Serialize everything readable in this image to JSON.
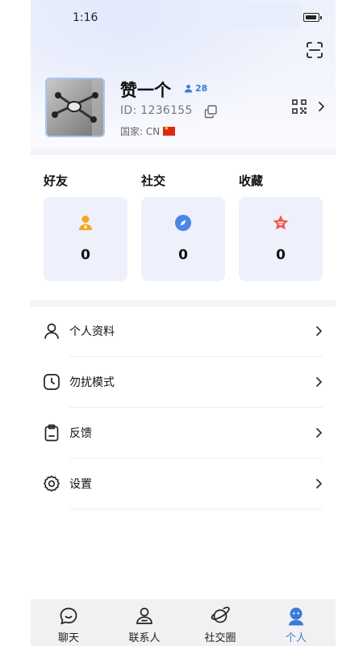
{
  "status_bar": {
    "time": "1:16"
  },
  "profile": {
    "username": "赞一个",
    "fans_count": "28",
    "id_text": "ID: 1236155",
    "country_text": "国家: CN"
  },
  "stats": [
    {
      "title": "好友",
      "value": "0",
      "icon": "friend-icon",
      "color": "#f5a623"
    },
    {
      "title": "社交",
      "value": "0",
      "icon": "compass-icon",
      "color": "#4a86e8"
    },
    {
      "title": "收藏",
      "value": "0",
      "icon": "star-icon",
      "color": "#ee5a4f"
    }
  ],
  "menu": [
    {
      "label": "个人资料",
      "icon": "person-icon"
    },
    {
      "label": "勿扰模式",
      "icon": "clock-icon"
    },
    {
      "label": "反馈",
      "icon": "clipboard-icon"
    },
    {
      "label": "设置",
      "icon": "gear-icon"
    }
  ],
  "tabs": [
    {
      "label": "聊天",
      "icon": "chat-icon"
    },
    {
      "label": "联系人",
      "icon": "contacts-icon"
    },
    {
      "label": "社交圈",
      "icon": "planet-icon"
    },
    {
      "label": "个人",
      "icon": "me-icon",
      "active": true
    }
  ],
  "colors": {
    "accent": "#3a7bd5",
    "card_bg": "#eef0fb"
  }
}
